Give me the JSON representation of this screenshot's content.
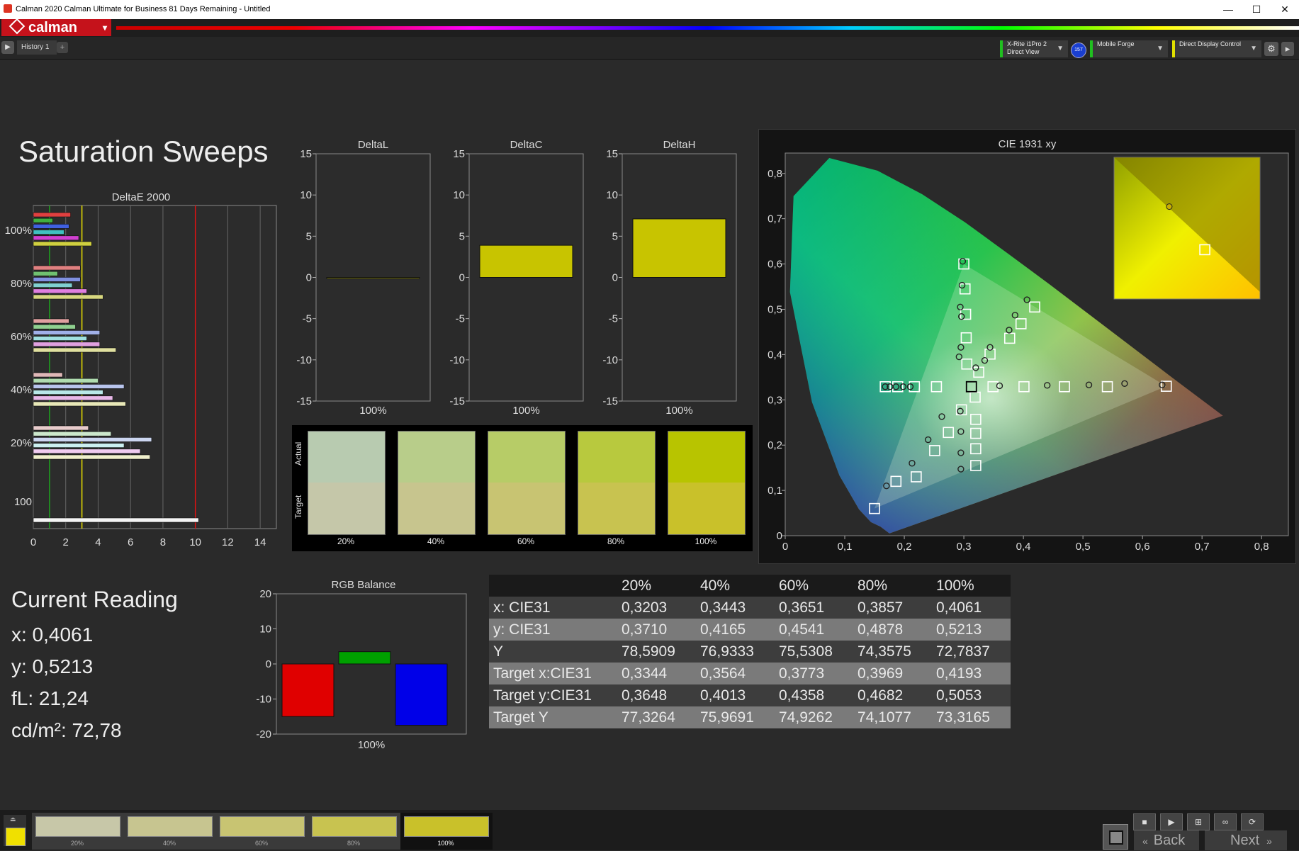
{
  "window": {
    "title": "Calman 2020 Calman Ultimate for Business 81 Days Remaining - Untitled",
    "min": "—",
    "max": "☐",
    "close": "✕"
  },
  "logo": {
    "text": "calman"
  },
  "toolbar": {
    "history_tab": "History 1",
    "add_tab": "+",
    "meter": {
      "line1": "X-Rite i1Pro 2",
      "line2": "Direct View"
    },
    "meter_badge": "157",
    "source": "Mobile Forge",
    "display": "Direct Display Control"
  },
  "page": {
    "title": "Saturation Sweeps"
  },
  "deltaE_chart": {
    "title": "DeltaE 2000",
    "ylabels": [
      "100%",
      "80%",
      "60%",
      "40%",
      "20%",
      "100"
    ],
    "xticks": [
      "0",
      "2",
      "4",
      "6",
      "8",
      "10",
      "12",
      "14"
    ],
    "xmax": 15,
    "threshold_lines": [
      {
        "value": 1,
        "color": "#1fa01f"
      },
      {
        "value": 3,
        "color": "#e8e000"
      },
      {
        "value": 10,
        "color": "#e01010"
      }
    ],
    "groups": [
      {
        "label": "100%",
        "bars": [
          {
            "value": 2.3,
            "color": "#e04040"
          },
          {
            "value": 1.2,
            "color": "#40b040"
          },
          {
            "value": 2.2,
            "color": "#4060e0"
          },
          {
            "value": 1.9,
            "color": "#40c0c0"
          },
          {
            "value": 2.8,
            "color": "#d040d0"
          },
          {
            "value": 3.6,
            "color": "#d0d040"
          }
        ]
      },
      {
        "label": "80%",
        "bars": [
          {
            "value": 2.9,
            "color": "#e08080"
          },
          {
            "value": 1.5,
            "color": "#70c070"
          },
          {
            "value": 2.9,
            "color": "#8090e0"
          },
          {
            "value": 2.4,
            "color": "#80d0d0"
          },
          {
            "value": 3.3,
            "color": "#e080e0"
          },
          {
            "value": 4.3,
            "color": "#d8d880"
          }
        ]
      },
      {
        "label": "60%",
        "bars": [
          {
            "value": 2.2,
            "color": "#e0a0a0"
          },
          {
            "value": 2.6,
            "color": "#90d090"
          },
          {
            "value": 4.1,
            "color": "#a0b0e8"
          },
          {
            "value": 3.3,
            "color": "#a0e0e0"
          },
          {
            "value": 4.1,
            "color": "#e0a0e0"
          },
          {
            "value": 5.1,
            "color": "#e0e0a0"
          }
        ]
      },
      {
        "label": "40%",
        "bars": [
          {
            "value": 1.8,
            "color": "#e0b8b8"
          },
          {
            "value": 4.0,
            "color": "#b0dcb0"
          },
          {
            "value": 5.6,
            "color": "#b8c4ec"
          },
          {
            "value": 4.3,
            "color": "#b8e8e8"
          },
          {
            "value": 4.9,
            "color": "#e8b8e8"
          },
          {
            "value": 5.7,
            "color": "#e8e8b8"
          }
        ]
      },
      {
        "label": "20%",
        "bars": [
          {
            "value": 3.4,
            "color": "#e8cccc"
          },
          {
            "value": 4.8,
            "color": "#cce8cc"
          },
          {
            "value": 7.3,
            "color": "#ccd6f0"
          },
          {
            "value": 5.6,
            "color": "#ccf0f0"
          },
          {
            "value": 6.6,
            "color": "#f0ccf0"
          },
          {
            "value": 7.2,
            "color": "#f0f0cc"
          }
        ]
      },
      {
        "label": "100",
        "bars": [
          {
            "value": 10.2,
            "color": "#f4f4f4"
          }
        ]
      }
    ]
  },
  "delta_charts": [
    {
      "title": "DeltaL",
      "value": -0.1,
      "xlabel": "100%"
    },
    {
      "title": "DeltaC",
      "value": 3.9,
      "xlabel": "100%"
    },
    {
      "title": "DeltaH",
      "value": 7.1,
      "xlabel": "100%"
    }
  ],
  "delta_yticks": [
    "15",
    "10",
    "5",
    "0",
    "-5",
    "-10",
    "-15"
  ],
  "swatches_panel": {
    "actual_label": "Actual",
    "target_label": "Target",
    "items": [
      {
        "label": "20%",
        "actual": "#b8cbb0",
        "target": "#c5c7a9"
      },
      {
        "label": "40%",
        "actual": "#b8cd8a",
        "target": "#c7c58e"
      },
      {
        "label": "60%",
        "actual": "#b7cc67",
        "target": "#c8c472"
      },
      {
        "label": "80%",
        "actual": "#b8c93e",
        "target": "#c8c350"
      },
      {
        "label": "100%",
        "actual": "#b8c400",
        "target": "#c9c12a"
      }
    ]
  },
  "cie_chart": {
    "title": "CIE 1931 xy",
    "xticks": [
      "0",
      "0,1",
      "0,2",
      "0,3",
      "0,4",
      "0,5",
      "0,6",
      "0,7",
      "0,8"
    ],
    "yticks": [
      "0",
      "0,1",
      "0,2",
      "0,3",
      "0,4",
      "0,5",
      "0,6",
      "0,7",
      "0,8"
    ],
    "gamut": {
      "red": [
        0.64,
        0.33
      ],
      "green": [
        0.3,
        0.6
      ],
      "blue": [
        0.15,
        0.06
      ]
    },
    "white": [
      0.3127,
      0.329
    ],
    "targets": [
      [
        0.254,
        0.329
      ],
      [
        0.217,
        0.329
      ],
      [
        0.189,
        0.329
      ],
      [
        0.168,
        0.329
      ],
      [
        0.15,
        0.06
      ],
      [
        0.349,
        0.329
      ],
      [
        0.401,
        0.329
      ],
      [
        0.469,
        0.329
      ],
      [
        0.541,
        0.329
      ],
      [
        0.64,
        0.33
      ],
      [
        0.305,
        0.379
      ],
      [
        0.304,
        0.437
      ],
      [
        0.303,
        0.489
      ],
      [
        0.302,
        0.545
      ],
      [
        0.3,
        0.6
      ],
      [
        0.296,
        0.278
      ],
      [
        0.274,
        0.228
      ],
      [
        0.251,
        0.188
      ],
      [
        0.22,
        0.13
      ],
      [
        0.186,
        0.12
      ],
      [
        0.325,
        0.361
      ],
      [
        0.344,
        0.401
      ],
      [
        0.377,
        0.436
      ],
      [
        0.396,
        0.468
      ],
      [
        0.419,
        0.505
      ],
      [
        0.319,
        0.306
      ],
      [
        0.32,
        0.257
      ],
      [
        0.32,
        0.226
      ],
      [
        0.32,
        0.192
      ],
      [
        0.32,
        0.155
      ]
    ],
    "measured": [
      [
        0.21,
        0.329
      ],
      [
        0.198,
        0.329
      ],
      [
        0.186,
        0.329
      ],
      [
        0.176,
        0.329
      ],
      [
        0.168,
        0.329
      ],
      [
        0.36,
        0.331
      ],
      [
        0.44,
        0.332
      ],
      [
        0.51,
        0.333
      ],
      [
        0.57,
        0.336
      ],
      [
        0.633,
        0.333
      ],
      [
        0.295,
        0.416
      ],
      [
        0.296,
        0.484
      ],
      [
        0.297,
        0.553
      ],
      [
        0.298,
        0.606
      ],
      [
        0.294,
        0.505
      ],
      [
        0.263,
        0.263
      ],
      [
        0.24,
        0.212
      ],
      [
        0.213,
        0.16
      ],
      [
        0.17,
        0.11
      ],
      [
        0.292,
        0.395
      ],
      [
        0.32,
        0.371
      ],
      [
        0.344,
        0.416
      ],
      [
        0.376,
        0.454
      ],
      [
        0.386,
        0.487
      ],
      [
        0.406,
        0.521
      ],
      [
        0.294,
        0.275
      ],
      [
        0.295,
        0.23
      ],
      [
        0.295,
        0.183
      ],
      [
        0.295,
        0.147
      ],
      [
        0.335,
        0.387
      ]
    ],
    "inset": {
      "measured": [
        0.4061,
        0.5213
      ],
      "target": [
        0.4193,
        0.5053
      ]
    }
  },
  "current_reading": {
    "title": "Current Reading",
    "x": "x: 0,4061",
    "y": "y: 0,5213",
    "fl": "fL: 21,24",
    "cdm2": "cd/m²: 72,78"
  },
  "rgb_balance": {
    "title": "RGB Balance",
    "yticks": [
      "20",
      "10",
      "0",
      "-10",
      "-20"
    ],
    "xlabel": "100%",
    "bars": [
      {
        "name": "R",
        "value": -15,
        "color": "#e00000"
      },
      {
        "name": "G",
        "value": 3.5,
        "color": "#00a000"
      },
      {
        "name": "B",
        "value": -17.5,
        "color": "#0000e8"
      }
    ]
  },
  "data_table": {
    "columns": [
      "",
      "20%",
      "40%",
      "60%",
      "80%",
      "100%"
    ],
    "rows": [
      {
        "label": "x: CIE31",
        "values": [
          "0,3203",
          "0,3443",
          "0,3651",
          "0,3857",
          "0,4061"
        ]
      },
      {
        "label": "y: CIE31",
        "values": [
          "0,3710",
          "0,4165",
          "0,4541",
          "0,4878",
          "0,5213"
        ]
      },
      {
        "label": "Y",
        "values": [
          "78,5909",
          "76,9333",
          "75,5308",
          "74,3575",
          "72,7837"
        ]
      },
      {
        "label": "Target x:CIE31",
        "values": [
          "0,3344",
          "0,3564",
          "0,3773",
          "0,3969",
          "0,4193"
        ]
      },
      {
        "label": "Target y:CIE31",
        "values": [
          "0,3648",
          "0,4013",
          "0,4358",
          "0,4682",
          "0,5053"
        ]
      },
      {
        "label": "Target Y",
        "values": [
          "77,3264",
          "75,9691",
          "74,9262",
          "74,1077",
          "73,3165"
        ]
      }
    ]
  },
  "bottom": {
    "current_color": "#f0e000",
    "swatches": [
      {
        "label": "20%",
        "color": "#c7c7a8"
      },
      {
        "label": "40%",
        "color": "#c7c590"
      },
      {
        "label": "60%",
        "color": "#c8c472"
      },
      {
        "label": "80%",
        "color": "#c8c350"
      },
      {
        "label": "100%",
        "color": "#c9c12a"
      }
    ],
    "back": "Back",
    "next": "Next"
  }
}
